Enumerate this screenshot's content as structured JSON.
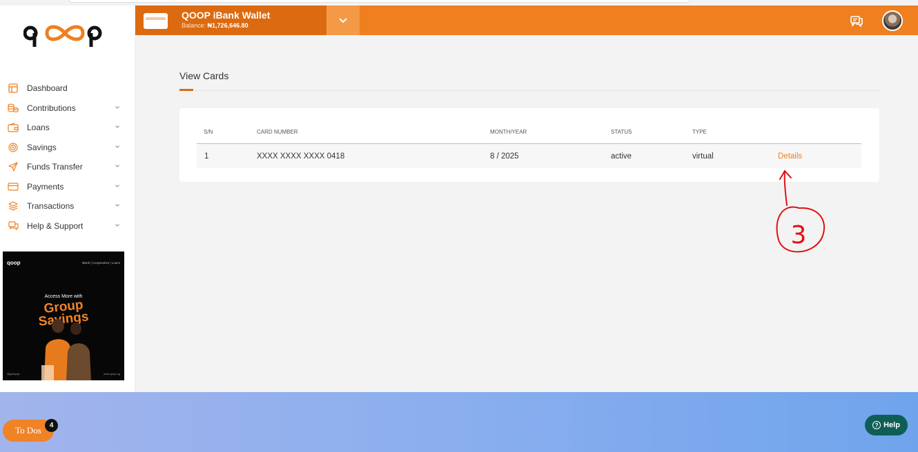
{
  "brand": {
    "logo_text": "qoop",
    "accent": "#ef7f1f",
    "accent_dark": "#dc6a10"
  },
  "header": {
    "wallet_title": "QOOP iBank Wallet",
    "balance_label": "Balance:",
    "balance_value": "₦1,726,646.80",
    "dropdown_icon": "chevron-down-icon",
    "support_icon": "support-chat-icon",
    "avatar": "user-avatar"
  },
  "sidebar": {
    "items": [
      {
        "label": "Dashboard",
        "icon": "dashboard-icon",
        "expandable": false
      },
      {
        "label": "Contributions",
        "icon": "coins-icon",
        "expandable": true
      },
      {
        "label": "Loans",
        "icon": "wallet-icon",
        "expandable": true
      },
      {
        "label": "Savings",
        "icon": "target-icon",
        "expandable": true
      },
      {
        "label": "Funds Transfer",
        "icon": "send-icon",
        "expandable": true
      },
      {
        "label": "Payments",
        "icon": "card-icon",
        "expandable": true
      },
      {
        "label": "Transactions",
        "icon": "layers-icon",
        "expandable": true
      },
      {
        "label": "Help & Support",
        "icon": "support-icon",
        "expandable": true
      }
    ],
    "promo": {
      "brand": "qoop",
      "tagline": "iBank | Cooperative | Loans",
      "headline_small": "Access More with",
      "headline_1": "Group",
      "headline_2": "Savings",
      "handle": "@getqoop",
      "website": "www.qoop.ng"
    }
  },
  "main": {
    "title": "View Cards",
    "table": {
      "columns": [
        "S/N",
        "CARD NUMBER",
        "MONTH/YEAR",
        "STATUS",
        "TYPE"
      ],
      "rows": [
        {
          "sn": "1",
          "card_number": "XXXX XXXX XXXX 0418",
          "month_year": "8 / 2025",
          "status": "active",
          "type": "virtual",
          "action": "Details"
        }
      ]
    }
  },
  "annotation": {
    "label": "3",
    "color": "#e01010"
  },
  "floating": {
    "todos_label": "To Dos",
    "todos_count": "4",
    "help_label": "Help"
  }
}
